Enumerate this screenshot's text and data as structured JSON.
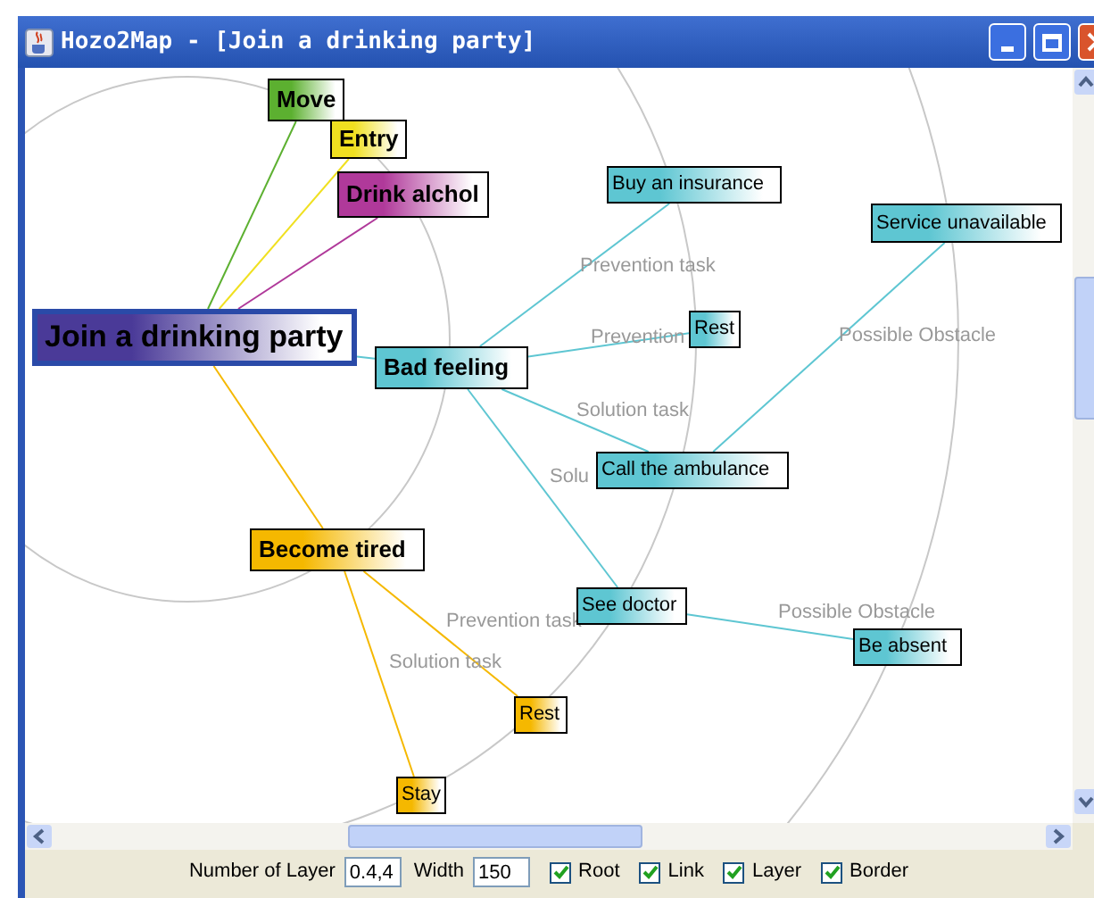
{
  "window": {
    "title": "Hozo2Map - [Join a drinking party]"
  },
  "map": {
    "nodes": [
      {
        "label": "Move",
        "color": "#5cb030",
        "kind": "major"
      },
      {
        "label": "Entry",
        "color": "#f0e020",
        "kind": "major"
      },
      {
        "label": "Drink alchol",
        "color": "#b0399a",
        "kind": "major"
      },
      {
        "label": "Join a drinking party",
        "color": "#4a3a98",
        "kind": "root"
      },
      {
        "label": "Bad feeling",
        "color": "#5ec6d2",
        "kind": "major"
      },
      {
        "label": "Buy an insurance",
        "color": "#5ec6d2",
        "kind": "minor"
      },
      {
        "label": "Service unavailable",
        "color": "#5ec6d2",
        "kind": "minor"
      },
      {
        "label": "Rest",
        "color": "#5ec6d2",
        "kind": "minor"
      },
      {
        "label": "Call the ambulance",
        "color": "#5ec6d2",
        "kind": "minor"
      },
      {
        "label": "See doctor",
        "color": "#5ec6d2",
        "kind": "minor"
      },
      {
        "label": "Be absent",
        "color": "#5ec6d2",
        "kind": "minor"
      },
      {
        "label": "Become tired",
        "color": "#f5b800",
        "kind": "major"
      },
      {
        "label": "Rest",
        "color": "#f5b800",
        "kind": "minor"
      },
      {
        "label": "Stay",
        "color": "#f5b800",
        "kind": "minor"
      }
    ],
    "link_labels": [
      "Prevention task",
      "Prevention",
      "Solution task",
      "Solu",
      "Possible Obstacle",
      "Possible Obstacle",
      "Prevention task",
      "Solution task"
    ]
  },
  "controls": {
    "layer_label": "Number of Layer",
    "layer_value": "0.4,4",
    "width_label": "Width",
    "width_value": "150",
    "options": [
      {
        "label": "Root",
        "checked": true
      },
      {
        "label": "Link",
        "checked": true
      },
      {
        "label": "Layer",
        "checked": true
      },
      {
        "label": "Border",
        "checked": true
      }
    ]
  }
}
